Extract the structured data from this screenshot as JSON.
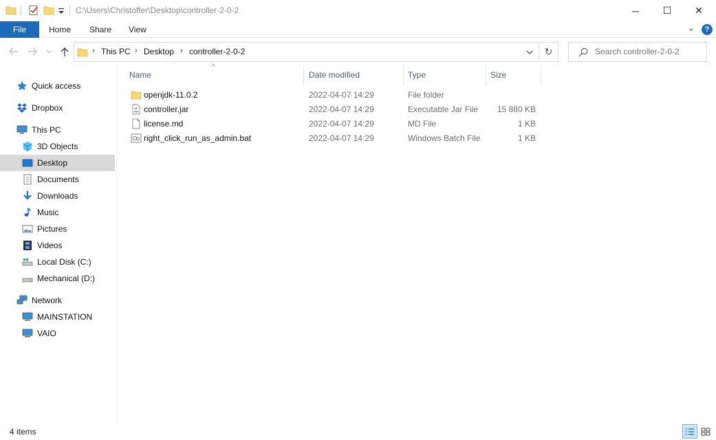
{
  "window": {
    "title": "C:\\Users\\Christoffer\\Desktop\\controller-2-0-2",
    "minimize": "─",
    "maximize": "☐",
    "close": "✕"
  },
  "ribbon": {
    "tabs": [
      "File",
      "Home",
      "Share",
      "View"
    ],
    "expand_glyph": "⌄",
    "help_glyph": "?"
  },
  "address": {
    "breadcrumbs": [
      "This PC",
      "Desktop",
      "controller-2-0-2"
    ],
    "separator": "›",
    "dropdown_glyph": "⌄",
    "refresh_glyph": "↻"
  },
  "search": {
    "placeholder": "Search controller-2-0-2"
  },
  "nav": {
    "quick_access": "Quick access",
    "dropbox": "Dropbox",
    "this_pc": "This PC",
    "objects3d": "3D Objects",
    "desktop": "Desktop",
    "documents": "Documents",
    "downloads": "Downloads",
    "music": "Music",
    "pictures": "Pictures",
    "videos": "Videos",
    "local_disk": "Local Disk (C:)",
    "mechanical": "Mechanical (D:)",
    "network": "Network",
    "mainstation": "MAINSTATION",
    "vaio": "VAIO"
  },
  "columns": {
    "name": "Name",
    "date": "Date modified",
    "type": "Type",
    "size": "Size",
    "sort_glyph": "^"
  },
  "files": [
    {
      "name": "openjdk-11.0.2",
      "date": "2022-04-07 14:29",
      "type": "File folder",
      "size": "",
      "icon": "folder-icon"
    },
    {
      "name": "controller.jar",
      "date": "2022-04-07 14:29",
      "type": "Executable Jar File",
      "size": "15 880 KB",
      "icon": "java-jar-icon"
    },
    {
      "name": "license.md",
      "date": "2022-04-07 14:29",
      "type": "MD File",
      "size": "1 KB",
      "icon": "document-icon"
    },
    {
      "name": "right_click_run_as_admin.bat",
      "date": "2022-04-07 14:29",
      "type": "Windows Batch File",
      "size": "1 KB",
      "icon": "batch-file-icon"
    }
  ],
  "status": {
    "item_count": "4 items"
  },
  "colors": {
    "accent": "#1f6ab8",
    "selection": "#d9d9d9",
    "header_text": "#4c607a"
  }
}
